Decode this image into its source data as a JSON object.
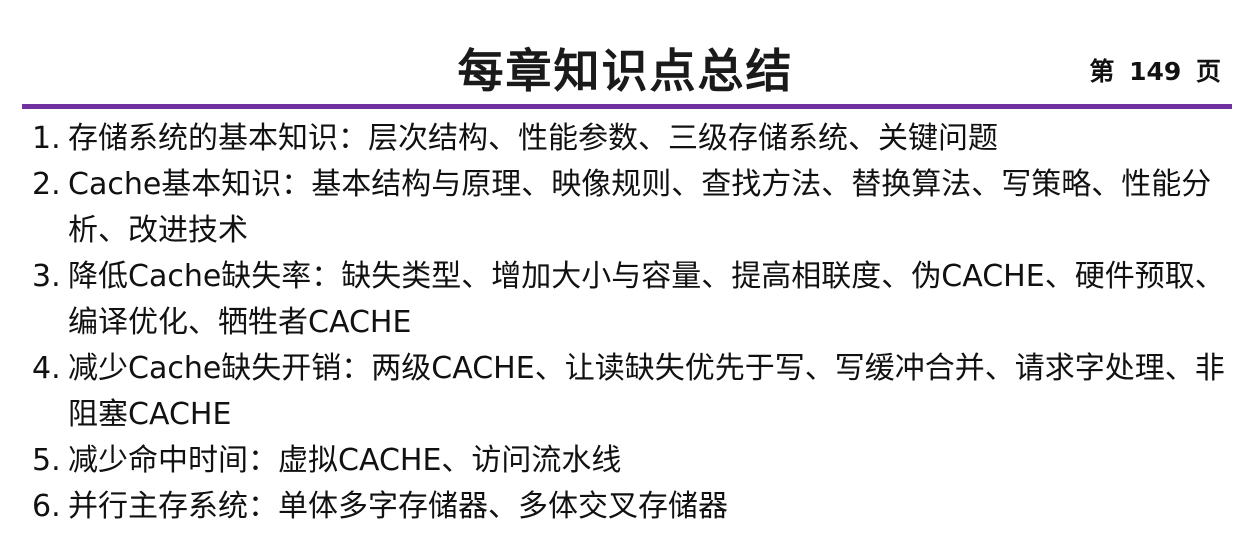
{
  "header": {
    "title": "每章知识点总结",
    "page_label": "第 149 页"
  },
  "accent_color": "#7030a0",
  "items": [
    {
      "num": "1.",
      "text": "存储系统的基本知识：层次结构、性能参数、三级存储系统、关键问题"
    },
    {
      "num": "2.",
      "text": "Cache基本知识：基本结构与原理、映像规则、查找方法、替换算法、写策略、性能分析、改进技术"
    },
    {
      "num": "3.",
      "text": "降低Cache缺失率：缺失类型、增加大小与容量、提高相联度、伪CACHE、硬件预取、编译优化、牺牲者CACHE"
    },
    {
      "num": "4.",
      "text": "减少Cache缺失开销：两级CACHE、让读缺失优先于写、写缓冲合并、请求字处理、非阻塞CACHE"
    },
    {
      "num": "5.",
      "text": "减少命中时间：虚拟CACHE、访问流水线"
    },
    {
      "num": "6.",
      "text": "并行主存系统：单体多字存储器、多体交叉存储器"
    }
  ]
}
